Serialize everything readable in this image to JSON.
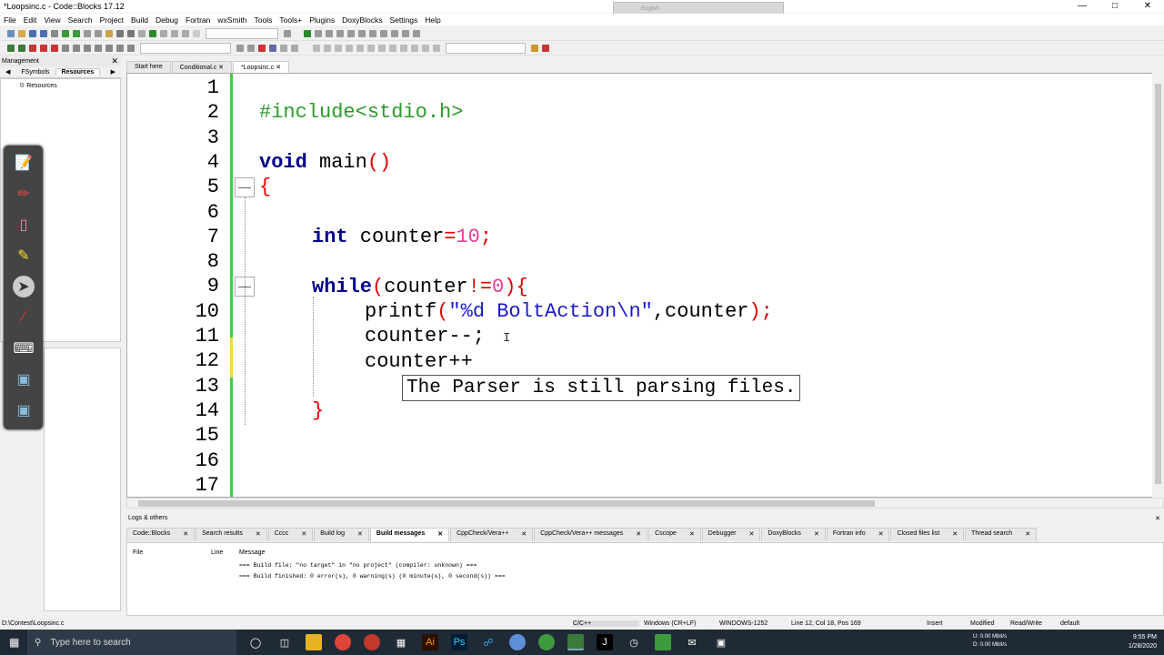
{
  "window": {
    "title": "*Loopsinc.c - Code::Blocks 17.12",
    "ime": "English"
  },
  "menu": [
    "File",
    "Edit",
    "View",
    "Search",
    "Project",
    "Build",
    "Debug",
    "Fortran",
    "wxSmith",
    "Tools",
    "Tools+",
    "Plugins",
    "DoxyBlocks",
    "Settings",
    "Help"
  ],
  "management": {
    "title": "Management",
    "tabs": [
      "FSymbols",
      "Resources"
    ],
    "tree_root": "Resources"
  },
  "file_tabs": [
    "Start here",
    "Conditional.c",
    "*Loopsinc.c"
  ],
  "editor": {
    "line_numbers": [
      "1",
      "2",
      "3",
      "4",
      "5",
      "6",
      "7",
      "8",
      "9",
      "10",
      "11",
      "12",
      "13",
      "14",
      "15",
      "16",
      "17"
    ],
    "include": "#include<stdio.h>",
    "void_kw": "void",
    "main_fn": " main",
    "parens": "()",
    "brace_open": "{",
    "int_kw": "int",
    "counter_decl": " counter",
    "eq": "=",
    "ten": "10",
    "semi": ";",
    "while_kw": "while",
    "paren_open": "(",
    "counter": "counter",
    "neq": "!=",
    "zero": "0",
    "paren_close_brace": "){",
    "printf_fn": "printf",
    "pf_open": "(",
    "pf_string": "\"%d BoltAction\\n\"",
    "pf_rest": ",counter",
    "pf_close": ");",
    "line11": "counter--;",
    "line12": "counter++",
    "brace_close": "}",
    "tooltip": "The Parser is still parsing files."
  },
  "logs": {
    "title": "Logs & others",
    "tabs": [
      "Code::Blocks",
      "Search results",
      "Cccc",
      "Build log",
      "Build messages",
      "CppCheck/Vera++",
      "CppCheck/Vera++ messages",
      "Cscope",
      "Debugger",
      "DoxyBlocks",
      "Fortran info",
      "Closed files list",
      "Thread search"
    ],
    "columns": [
      "File",
      "Line",
      "Message"
    ],
    "messages": [
      "=== Build file: \"no target\" in \"no project\" (compiler: unknown) ===",
      "=== Build finished: 0 error(s), 0 warning(s) (0 minute(s), 0 second(s)) ==="
    ]
  },
  "status": {
    "path": "D:\\Contest\\Loopsinc.c",
    "lang": "C/C++",
    "eol": "Windows (CR+LF)",
    "encoding": "WINDOWS-1252",
    "position": "Line 12, Col 18, Pos 169",
    "mode": "Insert",
    "modified": "Modified",
    "access": "Read/Write",
    "profile": "default"
  },
  "taskbar": {
    "search_placeholder": "Type here to search",
    "time": "9:55 PM",
    "date": "1/28/2020",
    "net_up": "0.00 Mbit/s",
    "net_down": "0.00 Mbit/s",
    "drive_u": "U:",
    "drive_d": "D:"
  }
}
